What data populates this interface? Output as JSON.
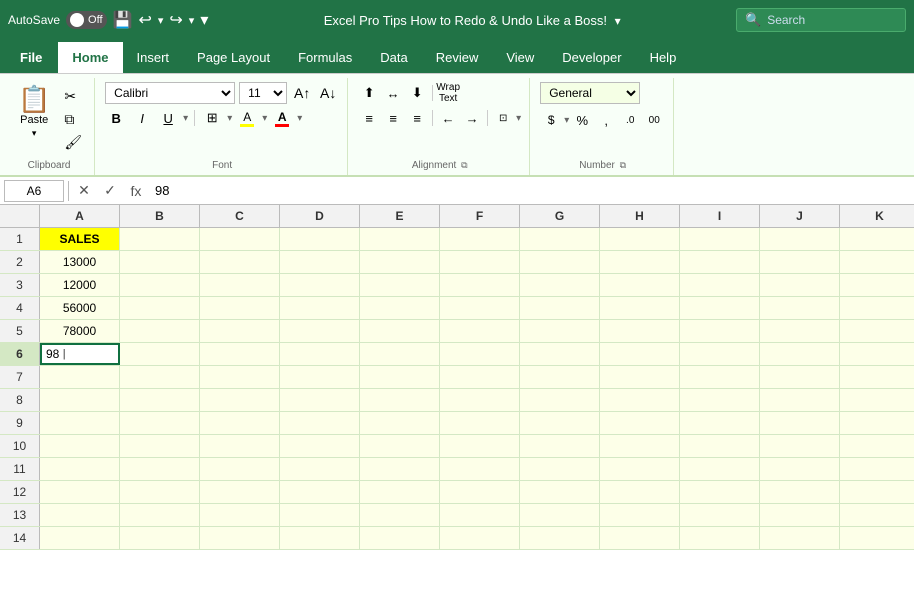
{
  "titleBar": {
    "autosave_label": "AutoSave",
    "autosave_state": "Off",
    "title": "Excel Pro Tips How to Redo & Undo Like a Boss!",
    "search_placeholder": "Search"
  },
  "ribbonTabs": [
    {
      "id": "file",
      "label": "File",
      "active": false
    },
    {
      "id": "home",
      "label": "Home",
      "active": true
    },
    {
      "id": "insert",
      "label": "Insert",
      "active": false
    },
    {
      "id": "page-layout",
      "label": "Page Layout",
      "active": false
    },
    {
      "id": "formulas",
      "label": "Formulas",
      "active": false
    },
    {
      "id": "data",
      "label": "Data",
      "active": false
    },
    {
      "id": "review",
      "label": "Review",
      "active": false
    },
    {
      "id": "view",
      "label": "View",
      "active": false
    },
    {
      "id": "developer",
      "label": "Developer",
      "active": false
    },
    {
      "id": "help",
      "label": "Help",
      "active": false
    }
  ],
  "ribbon": {
    "groups": {
      "clipboard": {
        "label": "Clipboard",
        "paste_label": "Paste"
      },
      "font": {
        "label": "Font",
        "font_name": "Calibri",
        "font_size": "11",
        "bold": "B",
        "italic": "I",
        "underline": "U",
        "wrap_text": "Wrap Text",
        "merge_center": "Merge & Center"
      },
      "alignment": {
        "label": "Alignment"
      },
      "number": {
        "label": "Number",
        "format": "General"
      }
    }
  },
  "formulaBar": {
    "cell_ref": "A6",
    "formula": "98"
  },
  "spreadsheet": {
    "columns": [
      "A",
      "B",
      "C",
      "D",
      "E",
      "F",
      "G",
      "H",
      "I",
      "J",
      "K"
    ],
    "rows": [
      {
        "num": 1,
        "a": "SALES",
        "isHeader": true
      },
      {
        "num": 2,
        "a": "13000"
      },
      {
        "num": 3,
        "a": "12000"
      },
      {
        "num": 4,
        "a": "56000"
      },
      {
        "num": 5,
        "a": "78000"
      },
      {
        "num": 6,
        "a": "98",
        "selected": true
      },
      {
        "num": 7,
        "a": ""
      },
      {
        "num": 8,
        "a": ""
      },
      {
        "num": 9,
        "a": ""
      },
      {
        "num": 10,
        "a": ""
      },
      {
        "num": 11,
        "a": ""
      },
      {
        "num": 12,
        "a": ""
      },
      {
        "num": 13,
        "a": ""
      },
      {
        "num": 14,
        "a": ""
      }
    ]
  }
}
